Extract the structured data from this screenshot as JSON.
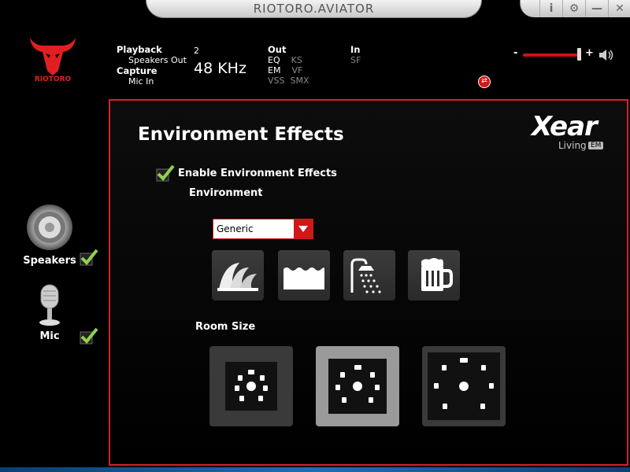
{
  "window": {
    "title": "RIOTORO.AVIATOR",
    "buttons": {
      "info": "i",
      "settings": "⚙",
      "minimize": "—",
      "close": "✕"
    }
  },
  "brand": {
    "logo_text": "RIOTORO"
  },
  "status": {
    "playback_label": "Playback",
    "playback_device": "Speakers Out",
    "capture_label": "Capture",
    "capture_device": "Mic In",
    "channels": "2",
    "sample_rate": "48 KHz",
    "out_label": "Out",
    "out_items": [
      "EQ",
      "KS",
      "EM",
      "VF",
      "VSS",
      "SMX"
    ],
    "in_label": "In",
    "in_items": [
      "SF"
    ]
  },
  "volume": {
    "minus": "-",
    "plus": "+",
    "level": 0.92
  },
  "sidebar": {
    "speakers_label": "Speakers",
    "mic_label": "Mic"
  },
  "panel": {
    "title": "Environment Effects",
    "xear_brand": "Xear",
    "xear_sub": "Living",
    "xear_badge": "EM",
    "enable_label": "Enable Environment Effects",
    "environment_label": "Environment",
    "environment_value": "Generic",
    "room_size_label": "Room Size"
  },
  "colors": {
    "accent": "#d4212b",
    "check": "#8fd14f"
  }
}
